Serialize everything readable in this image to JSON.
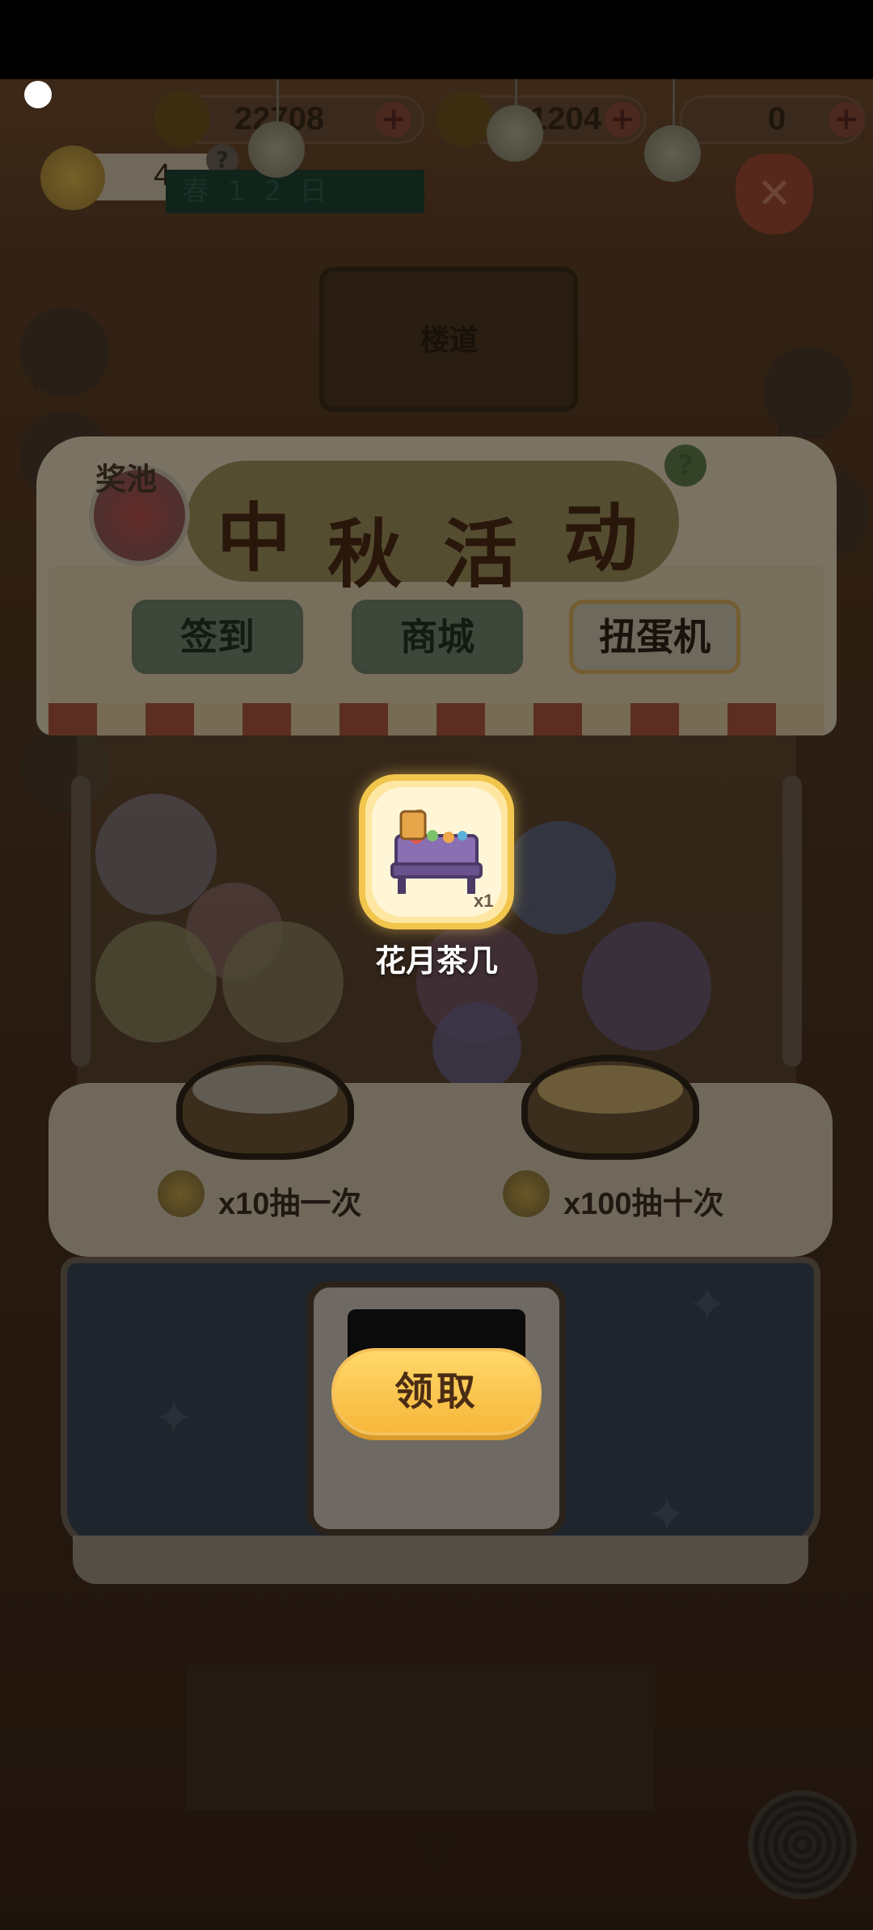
{
  "hud": {
    "banana_count": "22708",
    "flame_count": "1204",
    "third_count": "0",
    "tickets": "4",
    "help": "?",
    "season": "春 1 2 日"
  },
  "background": {
    "stair_sign": "楼道",
    "side_left": [
      "商城",
      "活"
    ],
    "side_left_bottom": "中",
    "side_right": [
      "前往",
      "等级"
    ]
  },
  "machine": {
    "prize_pool_label": "奖池",
    "title_chars": [
      "中",
      "秋",
      "活",
      "动"
    ],
    "help": "?",
    "tabs": [
      {
        "label": "签到",
        "active": false
      },
      {
        "label": "商城",
        "active": false
      },
      {
        "label": "扭蛋机",
        "active": true
      }
    ],
    "draw_once": "x10抽一次",
    "draw_ten": "x100抽十次"
  },
  "reward": {
    "item_name": "花月茶几",
    "quantity": "x1",
    "claim_label": "领取"
  },
  "colors": {
    "claim_button": "#f7b73a",
    "card_border": "#f2c64c",
    "overlay": "rgba(0,0,0,0.45)"
  }
}
